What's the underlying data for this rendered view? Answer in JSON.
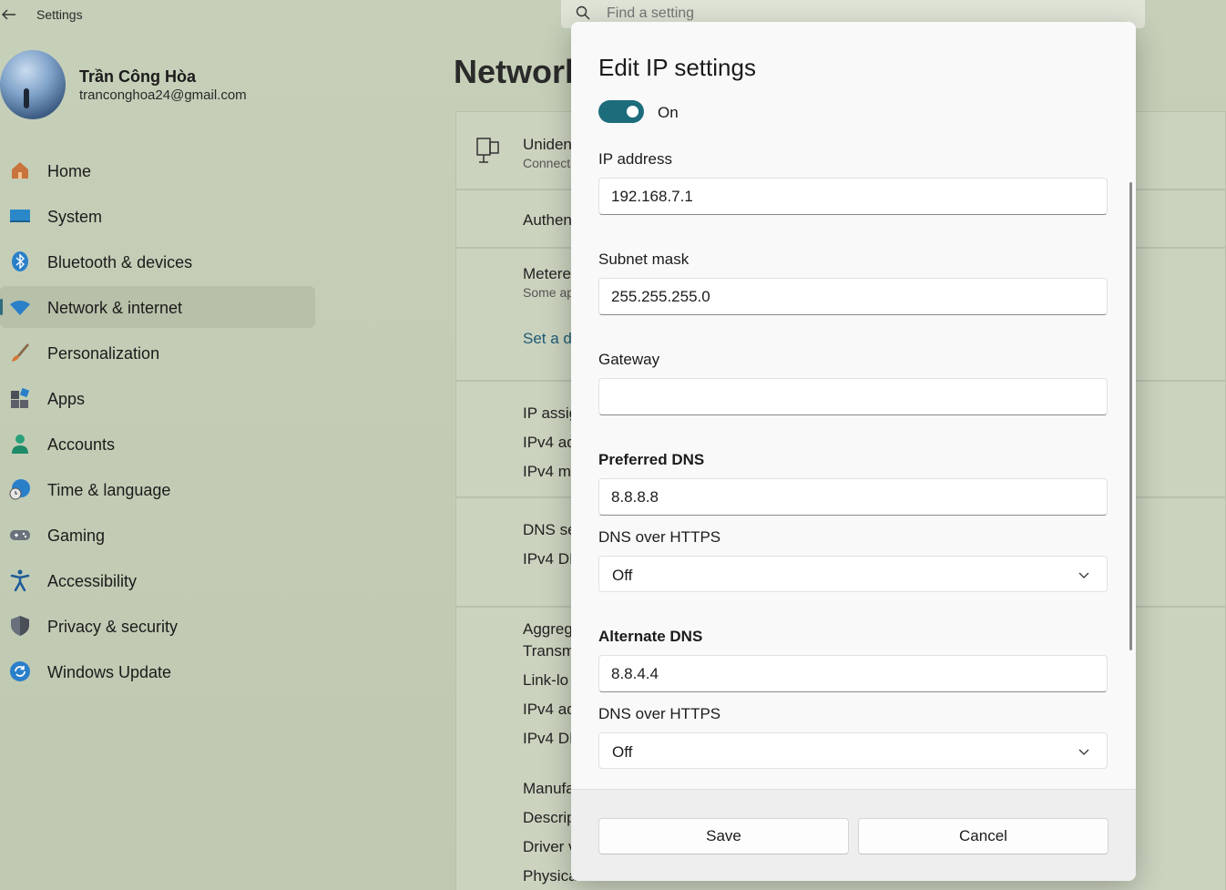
{
  "window": {
    "title": "Settings"
  },
  "search": {
    "placeholder": "Find a setting"
  },
  "profile": {
    "name": "Trần Công Hòa",
    "email": "tranconghoa24@gmail.com"
  },
  "sidebar": {
    "items": [
      {
        "label": "Home",
        "icon": "home-icon"
      },
      {
        "label": "System",
        "icon": "system-icon"
      },
      {
        "label": "Bluetooth & devices",
        "icon": "bluetooth-icon"
      },
      {
        "label": "Network & internet",
        "icon": "wifi-icon",
        "active": true
      },
      {
        "label": "Personalization",
        "icon": "brush-icon"
      },
      {
        "label": "Apps",
        "icon": "apps-icon"
      },
      {
        "label": "Accounts",
        "icon": "person-icon"
      },
      {
        "label": "Time & language",
        "icon": "globe-clock-icon"
      },
      {
        "label": "Gaming",
        "icon": "gamepad-icon"
      },
      {
        "label": "Accessibility",
        "icon": "accessibility-icon"
      },
      {
        "label": "Privacy & security",
        "icon": "shield-icon"
      },
      {
        "label": "Windows Update",
        "icon": "update-icon"
      }
    ]
  },
  "background": {
    "page_title": "Network",
    "network_name": "Uniden",
    "network_status": "Connect",
    "auth": "Authen",
    "metered": "Metere",
    "metered_sub": "Some ap",
    "set_link": "Set a d",
    "ip_assign": "IP assig",
    "ipv4_addr": "IPv4 ad",
    "ipv4_mask": "IPv4 m",
    "dns_server": "DNS se",
    "ipv4_dns": "IPv4 DI",
    "aggregate": "Aggreg",
    "transmit": "Transm",
    "link_local": "Link-lo",
    "ipv4_addr2": "IPv4 ad",
    "ipv4_dns2": "IPv4 DI",
    "manufacturer": "Manufa",
    "description": "Descrip",
    "driver": "Driver v",
    "physical": "Physica"
  },
  "dialog": {
    "title": "Edit IP settings",
    "toggle_label": "On",
    "ip_label": "IP address",
    "ip_value": "192.168.7.1",
    "subnet_label": "Subnet mask",
    "subnet_value": "255.255.255.0",
    "gateway_label": "Gateway",
    "gateway_value": "",
    "pref_dns_label": "Preferred DNS",
    "pref_dns_value": "8.8.8.8",
    "doh_label_1": "DNS over HTTPS",
    "doh_value_1": "Off",
    "alt_dns_label": "Alternate DNS",
    "alt_dns_value": "8.8.4.4",
    "doh_label_2": "DNS over HTTPS",
    "doh_value_2": "Off",
    "save_label": "Save",
    "cancel_label": "Cancel"
  },
  "colors": {
    "accent": "#1c6c7c",
    "background": "#c3cdb4",
    "dialog": "#f9f9f9"
  }
}
